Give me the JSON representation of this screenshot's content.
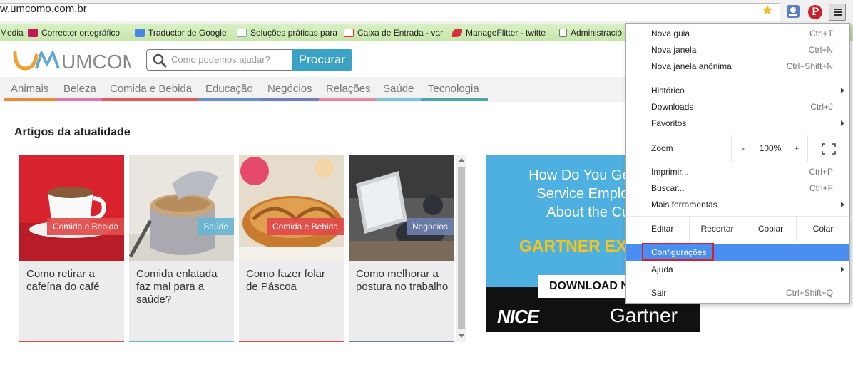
{
  "address_bar": {
    "url": "w.umcomo.com.br"
  },
  "bookmarks": [
    {
      "label": "Media",
      "icon": "none"
    },
    {
      "label": "Corrector ortográfico",
      "icon": "pdf-icon"
    },
    {
      "label": "Traductor de Google",
      "icon": "google-translate-icon"
    },
    {
      "label": "Soluções práticas para",
      "icon": "umcomo-icon"
    },
    {
      "label": "Caixa de Entrada - var",
      "icon": "gmail-icon"
    },
    {
      "label": "ManageFlitter - twitte",
      "icon": "manageflitter-icon"
    },
    {
      "label": "Administració",
      "icon": "page-icon"
    }
  ],
  "site": {
    "logo": "UMCOMO",
    "search_placeholder": "Como podemos ajudar?",
    "search_button": "Procurar",
    "nav": [
      {
        "label": "Animais",
        "color": "#e88b3d"
      },
      {
        "label": "Beleza",
        "color": "#d77ab4"
      },
      {
        "label": "Comida e Bebida",
        "color": "#e35c5c"
      },
      {
        "label": "Educação",
        "color": "#6d8fc9"
      },
      {
        "label": "Negócios",
        "color": "#6f7fb8"
      },
      {
        "label": "Relações",
        "color": "#e68aa0"
      },
      {
        "label": "Saúde",
        "color": "#7bc4dc"
      },
      {
        "label": "Tecnologia",
        "color": "#4fa6a6"
      }
    ],
    "section_title": "Artigos da atualidade",
    "cards": [
      {
        "tag": "Comida e Bebida",
        "tag_color": "#e24a4a",
        "title": "Como retirar a cafeína do café"
      },
      {
        "tag": "Saúde",
        "tag_color": "#67b6d4",
        "title": "Comida enlatada faz mal para a saúde?"
      },
      {
        "tag": "Comida e Bebida",
        "tag_color": "#e24a4a",
        "title": "Como fazer folar de Páscoa"
      },
      {
        "tag": "Negócios",
        "tag_color": "#6e7fae",
        "title": "Como melhorar a postura no trabalho"
      }
    ]
  },
  "ad": {
    "headline_1": "How Do You Get Your",
    "headline_2": "Service Employees",
    "headline_3": "About the Custo",
    "gartner_text": "GARTNER EXPL",
    "download": "DOWNLOAD NO",
    "logo_left": "NICE",
    "logo_right": "Gartner"
  },
  "menu": {
    "nova_guia": "Nova guia",
    "nova_guia_sc": "Ctrl+T",
    "nova_janela": "Nova janela",
    "nova_janela_sc": "Ctrl+N",
    "anonima": "Nova janela anônima",
    "anonima_sc": "Ctrl+Shift+N",
    "historico": "Histórico",
    "downloads": "Downloads",
    "downloads_sc": "Ctrl+J",
    "favoritos": "Favoritos",
    "zoom": "Zoom",
    "zoom_minus": "-",
    "zoom_value": "100%",
    "zoom_plus": "+",
    "imprimir": "Imprimir...",
    "imprimir_sc": "Ctrl+P",
    "buscar": "Buscar...",
    "buscar_sc": "Ctrl+F",
    "mais_ferramentas": "Mais ferramentas",
    "editar": "Editar",
    "recortar": "Recortar",
    "copiar": "Copiar",
    "colar": "Colar",
    "configuracoes": "Configurações",
    "ajuda": "Ajuda",
    "sair": "Sair",
    "sair_sc": "Ctrl+Shift+Q"
  }
}
